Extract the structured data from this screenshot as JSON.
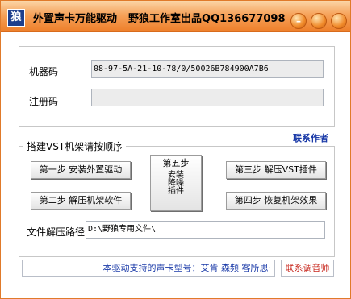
{
  "window": {
    "icon_glyph": "狼",
    "title_main": "外置声卡万能驱动",
    "title_credit": "野狼工作室出品QQ136677098",
    "accent_color": "#ee7f2a"
  },
  "registration": {
    "machine_code_label": "机器码",
    "machine_code_value": "08-97-5A-21-10-78/0/50026B784900A7B6",
    "reg_code_label": "注册码",
    "reg_code_value": ""
  },
  "group": {
    "title": "搭建VST机架请按顺序",
    "contact_author": "联系作者",
    "step1": "第一步 安装外置驱动",
    "step2": "第二步 解压机架软件",
    "step3": "第三步 解压VST插件",
    "step4": "第四步 恢复机架效果",
    "step5_title": "第五步",
    "step5_sub": "安装降噪插件",
    "path_label": "文件解压路径",
    "path_value": "D:\\野狼专用文件\\"
  },
  "footer": {
    "supported_cards": "本驱动支持的声卡型号：艾肯 森频 客所思·",
    "contact_tuner": "联系调音师"
  }
}
